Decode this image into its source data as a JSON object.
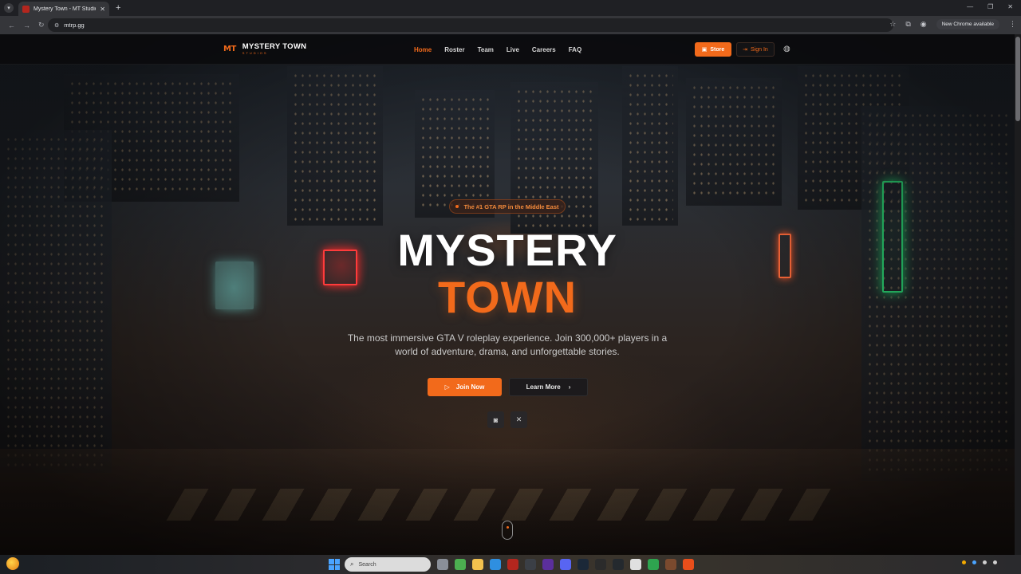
{
  "browser": {
    "tab_title": "Mystery Town - MT Studios | M",
    "tab_close": "✕",
    "new_tab": "+",
    "url": "mtrp.gg",
    "new_chrome_label": "New Chrome available",
    "window_controls": [
      "—",
      "❐",
      "✕"
    ]
  },
  "site_nav": {
    "logo_mark": "MT",
    "logo_name": "MYSTERY TOWN",
    "logo_sub": "STUDIOS",
    "links": [
      {
        "label": "Home",
        "active": true
      },
      {
        "label": "Roster",
        "active": false
      },
      {
        "label": "Team",
        "active": false
      },
      {
        "label": "Live",
        "active": false
      },
      {
        "label": "Careers",
        "active": false
      },
      {
        "label": "FAQ",
        "active": false
      }
    ],
    "store_label": "Store",
    "signin_label": "Sign In"
  },
  "hero": {
    "badge": "The #1 GTA RP in the Middle East",
    "title_line1": "MYSTERY",
    "title_line2": "TOWN",
    "description": "The most immersive GTA V roleplay experience. Join 300,000+ players in a world of adventure, drama, and unforgettable stories.",
    "join_label": "Join Now",
    "learn_label": "Learn More"
  },
  "taskbar": {
    "search_placeholder": "Search"
  },
  "colors": {
    "accent": "#f26a1b",
    "nav_bg": "#0a0a0c",
    "browser_chrome": "#35363a"
  },
  "icons": [
    "play-icon",
    "chevron-right-icon",
    "discord-icon",
    "x-icon",
    "globe-icon",
    "store-icon",
    "signin-icon"
  ]
}
